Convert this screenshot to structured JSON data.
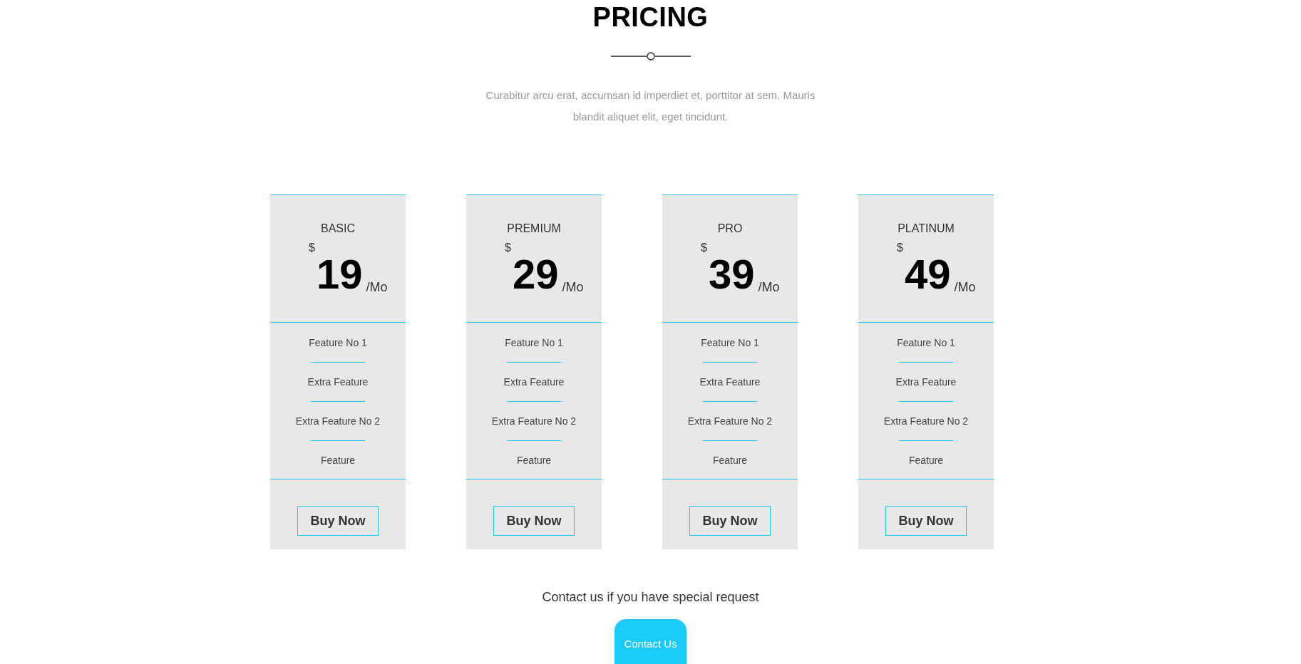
{
  "section": {
    "title": "PRICING",
    "intro": "Curabitur arcu erat, accumsan id imperdiet et, porttitor at sem. Mauris blandit aliquet elit, eget tincidunt."
  },
  "plans": [
    {
      "name": "BASIC",
      "currency": "$",
      "price": "19",
      "period": "/Mo",
      "features": [
        "Feature No 1",
        "Extra Feature",
        "Extra Feature No 2",
        "Feature"
      ],
      "button": "Buy Now"
    },
    {
      "name": "PREMIUM",
      "currency": "$",
      "price": "29",
      "period": "/Mo",
      "features": [
        "Feature No 1",
        "Extra Feature",
        "Extra Feature No 2",
        "Feature"
      ],
      "button": "Buy Now"
    },
    {
      "name": "PRO",
      "currency": "$",
      "price": "39",
      "period": "/Mo",
      "features": [
        "Feature No 1",
        "Extra Feature",
        "Extra Feature No 2",
        "Feature"
      ],
      "button": "Buy Now"
    },
    {
      "name": "PLATINUM",
      "currency": "$",
      "price": "49",
      "period": "/Mo",
      "features": [
        "Feature No 1",
        "Extra Feature",
        "Extra Feature No 2",
        "Feature"
      ],
      "button": "Buy Now"
    }
  ],
  "contact": {
    "text": "Contact us if you have special request",
    "button": "Contact Us"
  }
}
